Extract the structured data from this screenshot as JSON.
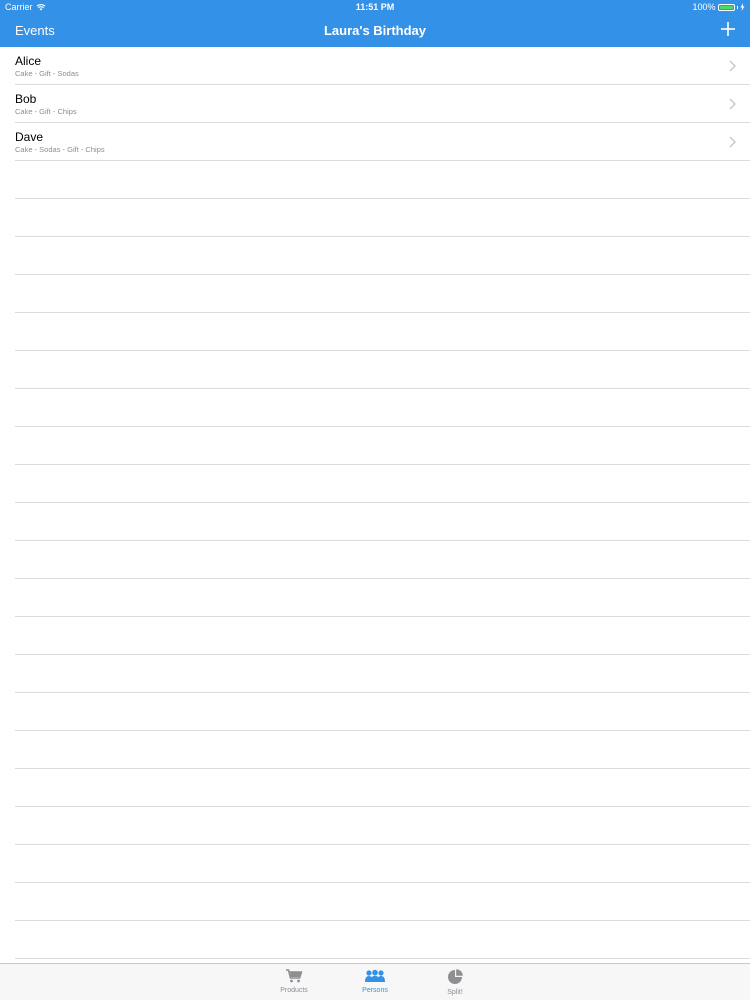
{
  "status_bar": {
    "carrier": "Carrier",
    "time": "11:51 PM",
    "battery": "100%"
  },
  "nav": {
    "back_label": "Events",
    "title": "Laura's Birthday",
    "add_icon": "plus-icon"
  },
  "persons": [
    {
      "name": "Alice",
      "items": "Cake - Gift - Sodas"
    },
    {
      "name": "Bob",
      "items": "Cake - Gift - Chips"
    },
    {
      "name": "Dave",
      "items": "Cake - Sodas - Gift - Chips"
    }
  ],
  "tabs": [
    {
      "label": "Products",
      "icon": "cart-icon",
      "active": false
    },
    {
      "label": "Persons",
      "icon": "persons-icon",
      "active": true
    },
    {
      "label": "Split!",
      "icon": "pie-chart-icon",
      "active": false
    }
  ],
  "colors": {
    "accent": "#3391e7",
    "battery": "#4cd964",
    "separator": "#dcdcdf",
    "inactive_tab": "#8e8e93"
  }
}
